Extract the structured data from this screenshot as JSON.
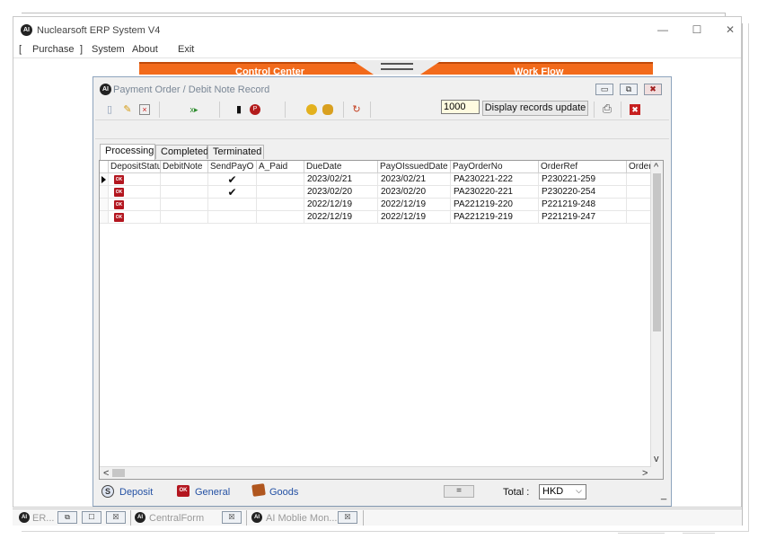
{
  "app": {
    "title": "Nuclearsoft ERP System V4",
    "logo_text": "AI"
  },
  "window_controls": {
    "minimize": "—",
    "maximize": "☐",
    "close": "✕"
  },
  "menu": {
    "bracket_open": "[",
    "purchase": "Purchase",
    "bracket_close": "]",
    "system": "System",
    "about": "About",
    "exit": "Exit"
  },
  "banner": {
    "left_label": "Control Center",
    "right_label": "Work Flow",
    "color": "#f26a1b"
  },
  "dialog": {
    "title": "Payment Order / Debit Note  Record",
    "buttons": {
      "minimize": "▭",
      "restore": "⧉",
      "close": "✖"
    }
  },
  "toolbar": {
    "icons": [
      "new-document-icon",
      "edit-pencil-icon",
      "delete-icon",
      "export-excel-icon",
      "flag-icon",
      "pdf-icon",
      "coin-icon",
      "hand-coin-icon",
      "refresh-icon",
      "print-icon",
      "close-red-icon"
    ],
    "record_limit": "1000",
    "update_button": "Display records update"
  },
  "tabs": [
    {
      "label": "Processing",
      "active": true
    },
    {
      "label": "Completed",
      "active": false
    },
    {
      "label": "Terminated",
      "active": false
    }
  ],
  "table": {
    "columns": [
      "DepositStatus",
      "DebitNote",
      "SendPayO",
      "A_Paid",
      "DueDate",
      "PayOIssuedDate",
      "PayOrderNo",
      "OrderRef",
      "OrderN"
    ],
    "rows": [
      {
        "status_badge": "OK",
        "debit_note": "",
        "send_payo": "✔",
        "a_paid": "",
        "due_date": "2023/02/21",
        "issued_date": "2023/02/21",
        "pay_order_no": "PA230221-222",
        "order_ref": "P230221-259",
        "order_n": "",
        "current": true
      },
      {
        "status_badge": "OK",
        "debit_note": "",
        "send_payo": "✔",
        "a_paid": "",
        "due_date": "2023/02/20",
        "issued_date": "2023/02/20",
        "pay_order_no": "PA230220-221",
        "order_ref": "P230220-254",
        "order_n": "",
        "current": false
      },
      {
        "status_badge": "OK",
        "debit_note": "",
        "send_payo": "",
        "a_paid": "",
        "due_date": "2022/12/19",
        "issued_date": "2022/12/19",
        "pay_order_no": "PA221219-220",
        "order_ref": "P221219-248",
        "order_n": "",
        "current": false
      },
      {
        "status_badge": "OK",
        "debit_note": "",
        "send_payo": "",
        "a_paid": "",
        "due_date": "2022/12/19",
        "issued_date": "2022/12/19",
        "pay_order_no": "PA221219-219",
        "order_ref": "P221219-247",
        "order_n": "",
        "current": false
      }
    ],
    "scroll": {
      "up": "^",
      "down": "v",
      "left": "<",
      "right": ">"
    }
  },
  "footer": {
    "deposit_icon": "S",
    "deposit": "Deposit",
    "general_icon": "OK",
    "general": "General",
    "goods": "Goods",
    "equals": "=",
    "total_label": "Total :",
    "currency": "HKD",
    "currency_chevron": "⌵",
    "trailing": "_"
  },
  "taskbar": {
    "items": [
      {
        "label": "ER...",
        "logo": "AI"
      },
      {
        "label": "CentralForm",
        "logo": "AI"
      },
      {
        "label": "AI Moblie Mon...",
        "logo": "AI"
      }
    ],
    "btn_restore": "⧉",
    "btn_max": "☐",
    "btn_close": "☒"
  }
}
